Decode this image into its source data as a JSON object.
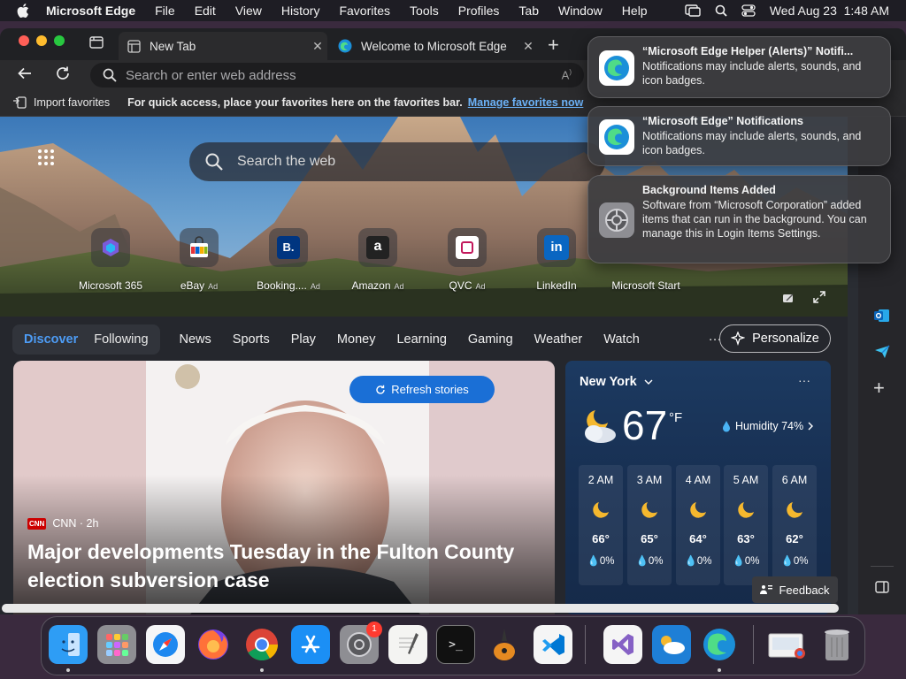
{
  "menubar": {
    "app_name": "Microsoft Edge",
    "items": [
      "File",
      "Edit",
      "View",
      "History",
      "Favorites",
      "Tools",
      "Profiles",
      "Tab",
      "Window",
      "Help"
    ],
    "clock": "Wed Aug 23  1:48 AM"
  },
  "tabs": [
    {
      "title": "New Tab"
    },
    {
      "title": "Welcome to Microsoft Edge"
    }
  ],
  "address_bar": {
    "placeholder": "Search or enter web address"
  },
  "favorites_bar": {
    "import_label": "Import favorites",
    "hint": "For quick access, place your favorites here on the favorites bar.",
    "manage_link": "Manage favorites now"
  },
  "newtab": {
    "search_placeholder": "Search the web",
    "quick_links": [
      {
        "label": "Microsoft 365",
        "ad": ""
      },
      {
        "label": "eBay",
        "ad": "Ad"
      },
      {
        "label": "Booking....",
        "ad": "Ad"
      },
      {
        "label": "Amazon",
        "ad": "Ad"
      },
      {
        "label": "QVC",
        "ad": "Ad"
      },
      {
        "label": "LinkedIn",
        "ad": ""
      },
      {
        "label": "Microsoft Start",
        "ad": ""
      }
    ]
  },
  "feed": {
    "pill_tabs": [
      "Discover",
      "Following"
    ],
    "nav_items": [
      "News",
      "Sports",
      "Play",
      "Money",
      "Learning",
      "Gaming",
      "Weather",
      "Watch"
    ],
    "more": "···",
    "personalize": "Personalize",
    "refresh": "Refresh stories",
    "story": {
      "source_logo": "CNN",
      "source": "CNN · 2h",
      "headline": "Major developments Tuesday in the Fulton County election subversion case"
    },
    "feedback": "Feedback"
  },
  "weather": {
    "city": "New York",
    "temp": "67",
    "unit": "°F",
    "humidity": "Humidity 74%",
    "hourly": [
      {
        "time": "2 AM",
        "temp": "66°",
        "precip": "0%"
      },
      {
        "time": "3 AM",
        "temp": "65°",
        "precip": "0%"
      },
      {
        "time": "4 AM",
        "temp": "64°",
        "precip": "0%"
      },
      {
        "time": "5 AM",
        "temp": "63°",
        "precip": "0%"
      },
      {
        "time": "6 AM",
        "temp": "62°",
        "precip": "0%"
      }
    ]
  },
  "notifications": [
    {
      "title": "“Microsoft Edge Helper (Alerts)” Notifi...",
      "body": "Notifications may include alerts, sounds, and icon badges."
    },
    {
      "title": "“Microsoft Edge” Notifications",
      "body": "Notifications may include alerts, sounds, and icon badges."
    },
    {
      "title": "Background Items Added",
      "body": "Software from “Microsoft Corporation” added items that can run in the background. You can manage this in Login Items Settings."
    }
  ],
  "dock": {
    "settings_badge": "1"
  },
  "colors": {
    "accent": "#4d9cf5",
    "link": "#6cb2f7",
    "menubar": "#1e1d24",
    "weather_bg": "#1c3a61",
    "refresh": "#1a6fd6"
  }
}
